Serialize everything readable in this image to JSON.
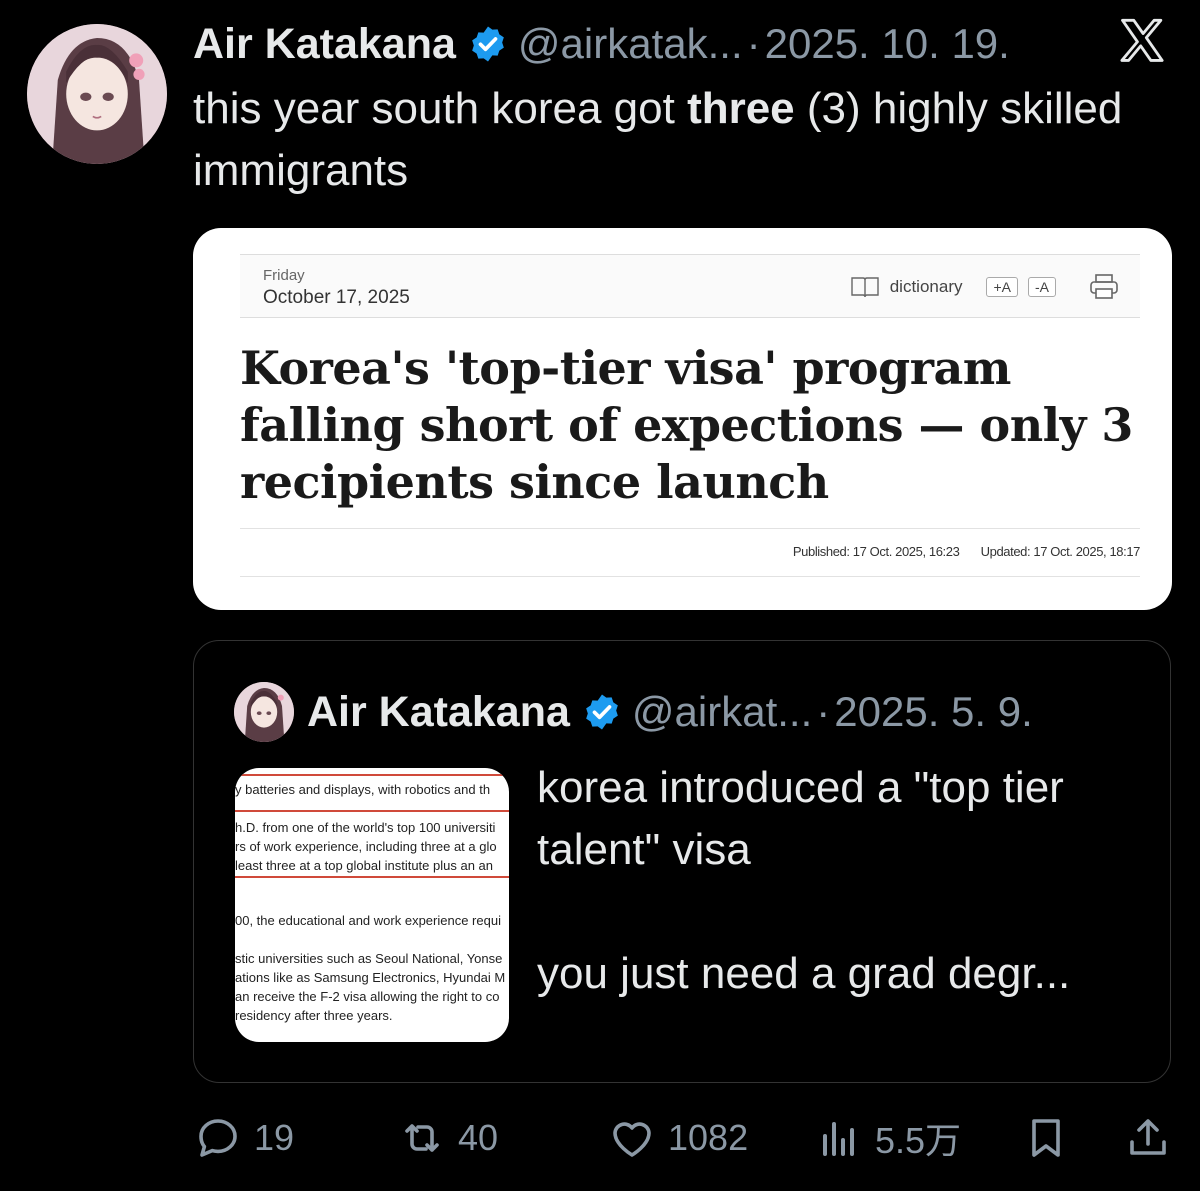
{
  "tweet": {
    "author_name": "Air Katakana",
    "handle": "@airkatak...",
    "separator": "·",
    "date": "2025. 10. 19.",
    "text_before": "this year south korea got ",
    "text_bold": "three",
    "text_after": " (3) highly skilled immigrants"
  },
  "article": {
    "day": "Friday",
    "date": "October 17, 2025",
    "dictionary_label": "dictionary",
    "font_up_label": "+A",
    "font_down_label": "-A",
    "headline": "Korea's 'top-tier visa' program falling short of expections — only 3 recipients since launch",
    "published": "Published: 17 Oct. 2025, 16:23",
    "updated": "Updated: 17 Oct. 2025, 18:17"
  },
  "quoted": {
    "author_name": "Air Katakana",
    "handle": "@airkat...",
    "separator": "·",
    "date": "2025. 5. 9.",
    "text": "korea introduced a \"top tier talent\" visa\n\nyou just need a grad degr...",
    "thumbnail_lines": [
      "y batteries and displays, with robotics and th",
      "h.D. from one of the world's top 100 universiti",
      "rs of work experience, including three at a glo",
      " least three at a top global institute plus an an",
      "00, the educational and work experience requi",
      "stic universities such as Seoul National, Yonse",
      "ations like as Samsung Electronics, Hyundai M",
      "an receive the F-2 visa allowing the right to co",
      "residency after three years."
    ]
  },
  "actions": {
    "replies": "19",
    "reposts": "40",
    "likes": "1082",
    "views": "5.5万"
  },
  "icons": {
    "verified": "verified-badge-icon",
    "x_logo": "x-logo-icon",
    "reply": "reply-icon",
    "repost": "repost-icon",
    "like": "heart-icon",
    "views": "views-icon",
    "bookmark": "bookmark-icon",
    "share": "share-icon"
  },
  "colors": {
    "background": "#000000",
    "text": "#e7e9ea",
    "secondary": "#8b98a5",
    "verified": "#1d9bf0"
  }
}
